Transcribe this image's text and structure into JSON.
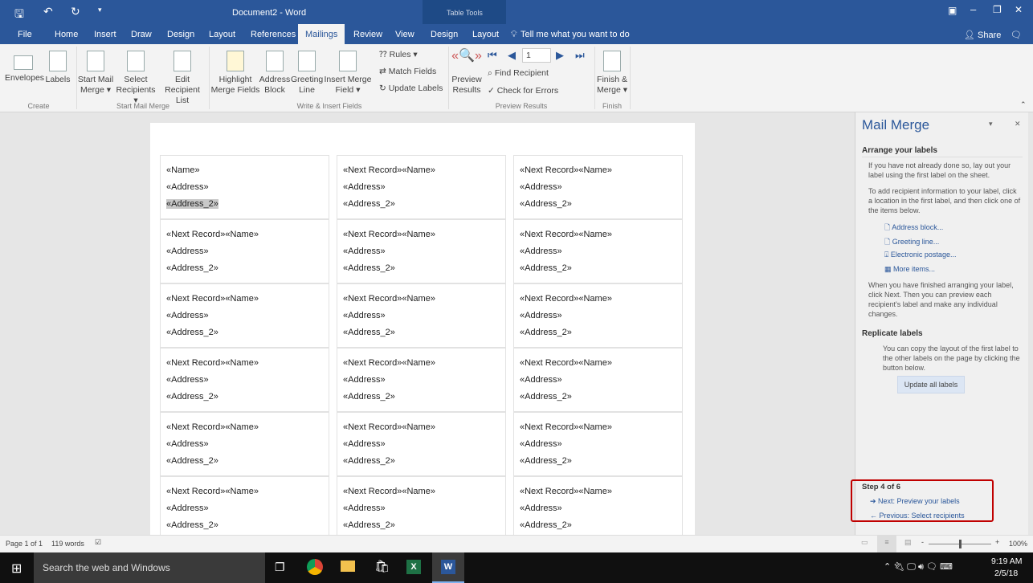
{
  "titlebar": {
    "title": "Document2 - Word",
    "context": "Table Tools",
    "user": "",
    "icons": [
      "save-icon",
      "undo-icon",
      "redo-icon",
      "customize-icon"
    ]
  },
  "tabs": [
    "File",
    "Home",
    "Insert",
    "Draw",
    "Design",
    "Layout",
    "References",
    "Mailings",
    "Review",
    "View",
    "Design",
    "Layout"
  ],
  "active_tab": "Mailings",
  "tell_me": "Tell me what you want to do",
  "share": "Share",
  "ribbon": {
    "envelopes": "Envelopes",
    "labels": "Labels",
    "create": "Create",
    "start_mail_merge": [
      "Start Mail",
      "Merge ▾"
    ],
    "select_recipients": [
      "Select",
      "Recipients ▾"
    ],
    "edit_list": [
      "Edit",
      "Recipient List"
    ],
    "start_group": "Start Mail Merge",
    "highlight": [
      "Highlight",
      "Merge Fields"
    ],
    "address_block": [
      "Address",
      "Block"
    ],
    "greeting_line": [
      "Greeting",
      "Line"
    ],
    "insert_merge": [
      "Insert Merge",
      "Field ▾"
    ],
    "rules": "Rules ▾",
    "match_fields": "Match Fields",
    "update_labels": "Update Labels",
    "write_group": "Write & Insert Fields",
    "preview": [
      "Preview",
      "Results"
    ],
    "record": "1",
    "find_recipient": "Find Recipient",
    "check_errors": "Check for Errors",
    "preview_group": "Preview Results",
    "finish": [
      "Finish &",
      "Merge ▾"
    ],
    "finish_group": "Finish"
  },
  "document": {
    "rows": [
      [
        "«Name»",
        "«Next Record»«Name»",
        "«Next Record»«Name»"
      ],
      [
        "«Next Record»«Name»",
        "«Next Record»«Name»",
        "«Next Record»«Name»"
      ],
      [
        "«Next Record»«Name»",
        "«Next Record»«Name»",
        "«Next Record»«Name»"
      ],
      [
        "«Next Record»«Name»",
        "«Next Record»«Name»",
        "«Next Record»«Name»"
      ],
      [
        "«Next Record»«Name»",
        "«Next Record»«Name»",
        "«Next Record»«Name»"
      ],
      [
        "«Next Record»«Name»",
        "«Next Record»«Name»",
        "«Next Record»«Name»"
      ]
    ],
    "address": "«Address»",
    "address2": "«Address_2»"
  },
  "pane": {
    "title": "Mail Merge",
    "arrange": "Arrange your labels",
    "p1": "If you have not already done so, lay out your label using the first label on the sheet.",
    "p2": "To add recipient information to your label, click a location in the first label, and then click one of the items below.",
    "links": [
      "Address block...",
      "Greeting line...",
      "Electronic postage...",
      "More items..."
    ],
    "p3": "When you have finished arranging your label, click Next. Then you can preview each recipient's label and make any individual changes.",
    "replicate": "Replicate labels",
    "p4": "You can copy the layout of the first label to the other labels on the page by clicking the button below.",
    "update_all": "Update all labels",
    "step": "Step 4 of 6",
    "next": "Next: Preview your labels",
    "previous": "Previous: Select recipients",
    "highlight_color": "#c00000"
  },
  "status": {
    "page": "Page 1 of 1",
    "words": "119 words",
    "zoom": "100%",
    "zoom_level": 100
  },
  "taskbar": {
    "search": "Search the web and Windows",
    "time": "9:19 AM",
    "date": "2/5/18"
  }
}
